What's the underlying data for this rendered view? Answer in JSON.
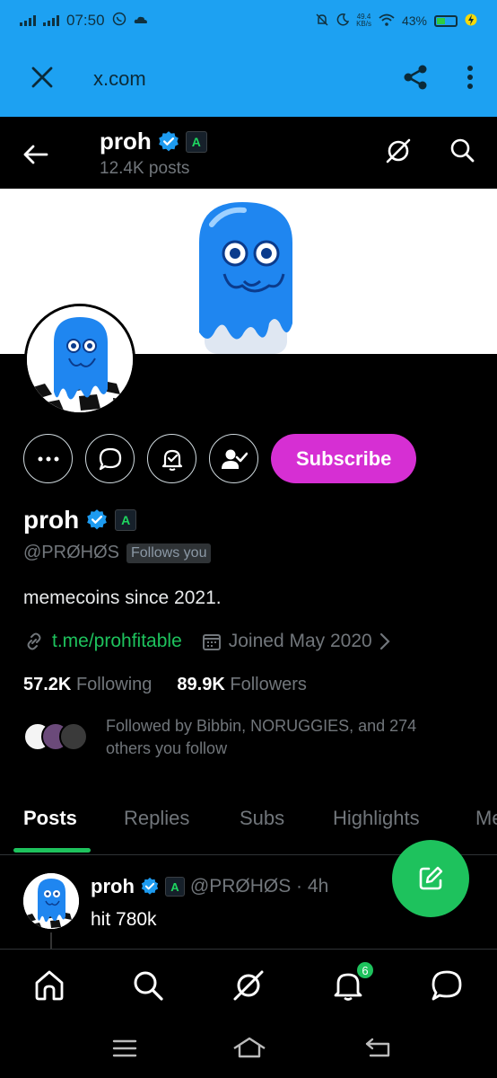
{
  "status_bar": {
    "time": "07:50",
    "net_speed_value": "49.4",
    "net_speed_unit": "KB/s",
    "battery": "43%"
  },
  "browser": {
    "url": "x.com",
    "close_icon": "close-icon",
    "share_icon": "share-icon",
    "menu_icon": "more-vertical-icon"
  },
  "profile_header": {
    "name": "proh",
    "posts_count": "12.4K posts",
    "affiliate_badge": "A"
  },
  "profile": {
    "display_name": "proh",
    "affiliate_badge": "A",
    "handle": "@PRØHØS",
    "follows_you": "Follows you",
    "bio": "memecoins since 2021.",
    "link": "t.me/prohfitable",
    "joined": "Joined May 2020",
    "following_count": "57.2K",
    "following_label": "Following",
    "followers_count": "89.9K",
    "followers_label": "Followers",
    "followed_by": "Followed by Bibbin, NORUGGIES, and 274 others you follow",
    "subscribe_label": "Subscribe"
  },
  "tabs": [
    {
      "label": "Posts",
      "active": true
    },
    {
      "label": "Replies",
      "active": false
    },
    {
      "label": "Subs",
      "active": false
    },
    {
      "label": "Highlights",
      "active": false
    },
    {
      "label": "Me",
      "active": false
    }
  ],
  "post": {
    "author": "proh",
    "affiliate_badge": "A",
    "handle_time": "@PRØHØS · 4h",
    "text": "hit 780k"
  },
  "bottom_nav": {
    "notifications_badge": "6"
  },
  "colors": {
    "accent_green": "#1ec25d",
    "subscribe_pink": "#d62fd3",
    "browser_blue": "#1da1f2",
    "verified_blue": "#1d9bf0"
  }
}
